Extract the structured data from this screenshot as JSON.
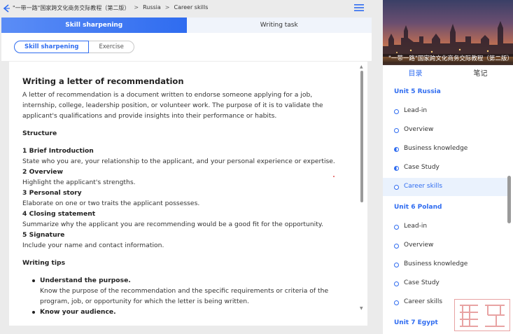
{
  "breadcrumb": {
    "book": "\"一带一路\"国家跨文化商务交际教程（第二版）",
    "unit": "Russia",
    "page": "Career skills",
    "sep": ">"
  },
  "tabs": [
    {
      "label": "Skill sharpening",
      "active": true
    },
    {
      "label": "Writing task",
      "active": false
    }
  ],
  "subtabs": [
    {
      "label": "Skill sharpening",
      "active": true
    },
    {
      "label": "Exercise",
      "active": false
    }
  ],
  "doc": {
    "title": "Writing a letter of recommendation",
    "intro": "A letter of recommendation is a document written to endorse someone applying for a job, internship, college, leadership position, or volunteer work. The purpose of it is to validate the applicant's qualifications and provide insights into their performance or habits.",
    "structure_heading": "Structure",
    "structure": [
      {
        "heading": "1 Brief Introduction",
        "text": "State who you are, your relationship to the applicant, and your personal experience or expertise."
      },
      {
        "heading": "2 Overview",
        "text": "Highlight the applicant's strengths."
      },
      {
        "heading": "3 Personal story",
        "text": "Elaborate on one or two traits the applicant possesses."
      },
      {
        "heading": "4 Closing statement",
        "text": "Summarize why the applicant you are recommending would be a good fit for the opportunity."
      },
      {
        "heading": "5 Signature",
        "text": "Include your name and contact information."
      }
    ],
    "tips_heading": "Writing tips",
    "tips": [
      {
        "heading": "Understand the purpose.",
        "text": "Know the purpose of the recommendation and the specific requirements or criteria of the program, job, or opportunity for which the letter is being written."
      },
      {
        "heading": "Know your audience.",
        "text": ""
      }
    ]
  },
  "cover": {
    "title": "\"一带一路\"国家跨文化商务交际教程（第二版）"
  },
  "right_tabs": [
    {
      "label": "目录",
      "active": true
    },
    {
      "label": "笔记",
      "active": false
    }
  ],
  "toc": {
    "unit5": "Unit 5 Russia",
    "unit5_items": [
      {
        "label": "Lead-in",
        "status": "empty"
      },
      {
        "label": "Overview",
        "status": "empty"
      },
      {
        "label": "Business knowledge",
        "status": "half"
      },
      {
        "label": "Case Study",
        "status": "half"
      },
      {
        "label": "Career skills",
        "status": "current"
      }
    ],
    "unit6": "Unit 6 Poland",
    "unit6_items": [
      {
        "label": "Lead-in",
        "status": "empty"
      },
      {
        "label": "Overview",
        "status": "empty"
      },
      {
        "label": "Business knowledge",
        "status": "empty"
      },
      {
        "label": "Case Study",
        "status": "empty"
      },
      {
        "label": "Career skills",
        "status": "empty"
      }
    ],
    "unit7": "Unit 7 Egypt"
  },
  "colors": {
    "accent": "#2f6cf0",
    "current_row_bg": "#eaf2fd",
    "stamp": "#e8a3a3"
  }
}
